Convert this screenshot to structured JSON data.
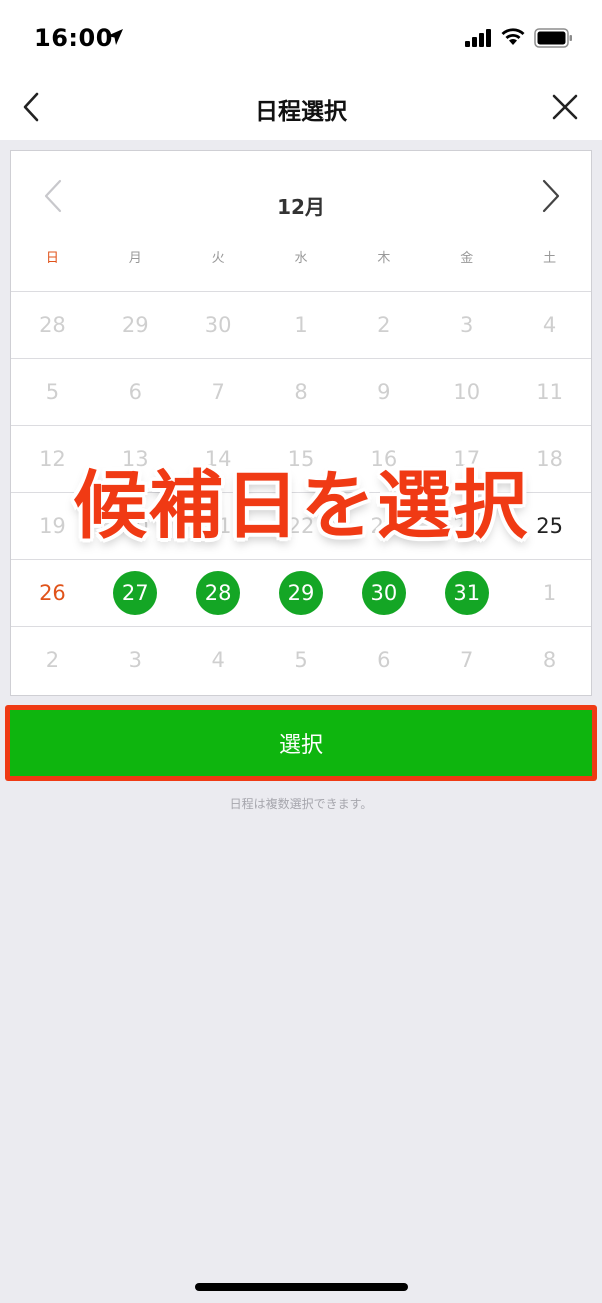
{
  "status_bar": {
    "time": "16:00",
    "icons": [
      "location-arrow-icon",
      "cellular-signal-icon",
      "wifi-icon",
      "battery-icon"
    ]
  },
  "nav": {
    "title": "日程選択",
    "back_icon": "chevron-left-icon",
    "close_icon": "close-icon"
  },
  "calendar": {
    "month": "12月",
    "weekdays": [
      "日",
      "月",
      "火",
      "水",
      "木",
      "金",
      "土"
    ],
    "weeks": [
      [
        "28",
        "29",
        "30",
        "1",
        "2",
        "3",
        "4"
      ],
      [
        "5",
        "6",
        "7",
        "8",
        "9",
        "10",
        "11"
      ],
      [
        "12",
        "13",
        "14",
        "15",
        "16",
        "17",
        "18"
      ],
      [
        "19",
        "20",
        "21",
        "22",
        "23",
        "24",
        "25"
      ],
      [
        "26",
        "27",
        "28",
        "29",
        "30",
        "31",
        "1"
      ],
      [
        "2",
        "3",
        "4",
        "5",
        "6",
        "7",
        "8"
      ]
    ],
    "selected_dates": [
      "27",
      "28",
      "29",
      "30",
      "31"
    ],
    "colors": {
      "selected": "#14a625",
      "sunday": "#e0531a",
      "button": "#0eb50e",
      "highlight": "#ef3a14"
    }
  },
  "overlay_text": "候補日を選択",
  "select_button": "選択",
  "hint": "日程は複数選択できます。"
}
